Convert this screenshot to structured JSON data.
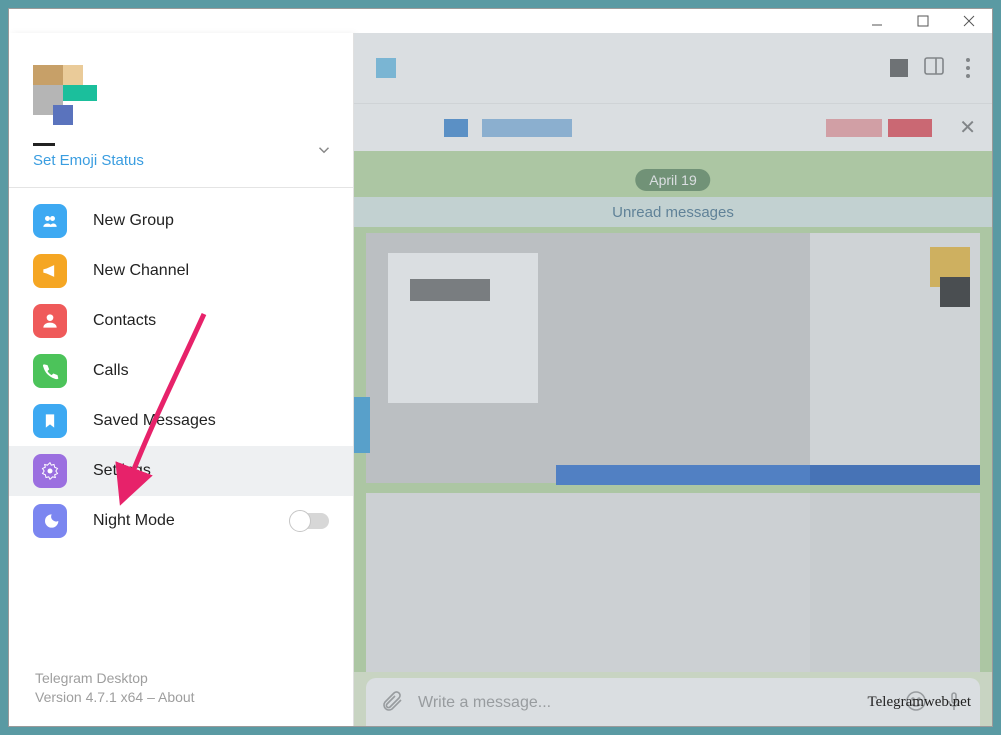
{
  "window": {
    "minimize": "–",
    "maximize": "▢",
    "close": "✕"
  },
  "drawer": {
    "emoji_status": "Set Emoji Status",
    "items": [
      {
        "label": "New Group",
        "color": "#3da9f2",
        "icon": "group"
      },
      {
        "label": "New Channel",
        "color": "#f5a623",
        "icon": "megaphone"
      },
      {
        "label": "Contacts",
        "color": "#ef5a5a",
        "icon": "person"
      },
      {
        "label": "Calls",
        "color": "#4cc35a",
        "icon": "phone"
      },
      {
        "label": "Saved Messages",
        "color": "#3da9f2",
        "icon": "bookmark"
      },
      {
        "label": "Settings",
        "color": "#9b6fe0",
        "icon": "gear"
      },
      {
        "label": "Night Mode",
        "color": "#7b86f0",
        "icon": "moon"
      }
    ],
    "footer_app": "Telegram Desktop",
    "footer_ver": "Version 4.7.1 x64 – ",
    "footer_about": "About"
  },
  "chat": {
    "date": "April 19",
    "unread": "Unread messages"
  },
  "input": {
    "placeholder": "Write a message..."
  },
  "watermark": "Telegramweb.net"
}
